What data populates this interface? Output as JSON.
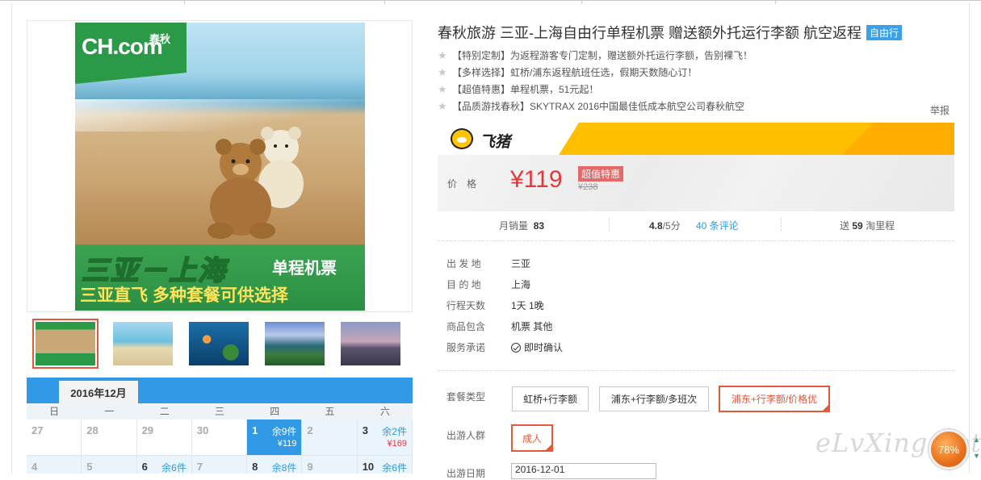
{
  "product": {
    "title": "春秋旅游 三亚-上海自由行单程机票 赠送额外托运行李额 航空返程",
    "tag": "自由行",
    "features": [
      "【特别定制】为返程游客专门定制，赠送额外托运行李额，告别裸飞！",
      "【多样选择】虹桥/浦东返程航班任选，假期天数随心订！",
      "【超值特惠】单程机票，51元起！",
      "【品质游找春秋】SKYTRAX 2016中国最佳低成本航空公司春秋航空"
    ],
    "report": "举报"
  },
  "poster": {
    "logo": "CH.com",
    "logo_cn": "春秋",
    "headline": "三亚－上海",
    "headline_suffix": "单程机票",
    "subline": "三亚直飞  多种套餐可供选择"
  },
  "feizhu": {
    "name": "飞猪"
  },
  "price": {
    "label": "价格",
    "current": "¥119",
    "badge": "超值特惠",
    "original": "¥238"
  },
  "stats": {
    "sales_label": "月销量",
    "sales_value": "83",
    "score": "4.8",
    "score_suffix": "/5分",
    "reviews": "40 条评论",
    "miles_prefix": "送",
    "miles_value": "59",
    "miles_suffix": "淘里程"
  },
  "details": [
    {
      "key": "出 发 地",
      "value": "三亚"
    },
    {
      "key": "目 的 地",
      "value": "上海"
    },
    {
      "key": "行程天数",
      "value": "1天 1晚"
    },
    {
      "key": "商品包含",
      "value": "机票  其他"
    },
    {
      "key": "服务承诺",
      "value": "即时确认"
    }
  ],
  "package": {
    "label": "套餐类型",
    "options": [
      "虹桥+行李额",
      "浦东+行李额/多班次",
      "浦东+行李额/价格优"
    ],
    "selected": 2
  },
  "crowd": {
    "label": "出游人群",
    "option": "成人"
  },
  "date": {
    "label": "出游日期",
    "value": "2016-12-01"
  },
  "calendar": {
    "month": "2016年12月",
    "weekdays": [
      "日",
      "一",
      "二",
      "三",
      "四",
      "五",
      "六"
    ],
    "week1": [
      {
        "d": "27"
      },
      {
        "d": "28"
      },
      {
        "d": "29"
      },
      {
        "d": "30"
      },
      {
        "d": "1",
        "rem": "余9件",
        "price": "¥119"
      },
      {
        "d": "2"
      },
      {
        "d": "3",
        "rem": "余2件",
        "price": "¥169"
      }
    ],
    "week2": [
      {
        "d": "4"
      },
      {
        "d": "5"
      },
      {
        "d": "6",
        "rem": "余6件"
      },
      {
        "d": "7"
      },
      {
        "d": "8",
        "rem": "余8件"
      },
      {
        "d": "9"
      },
      {
        "d": "10",
        "rem": "余6件"
      }
    ]
  },
  "watermark": "eLvXing.net",
  "badge": "78%",
  "colors": {
    "accent": "#e4393c",
    "blue": "#3299e6",
    "feizhu": "#ffbf00"
  }
}
